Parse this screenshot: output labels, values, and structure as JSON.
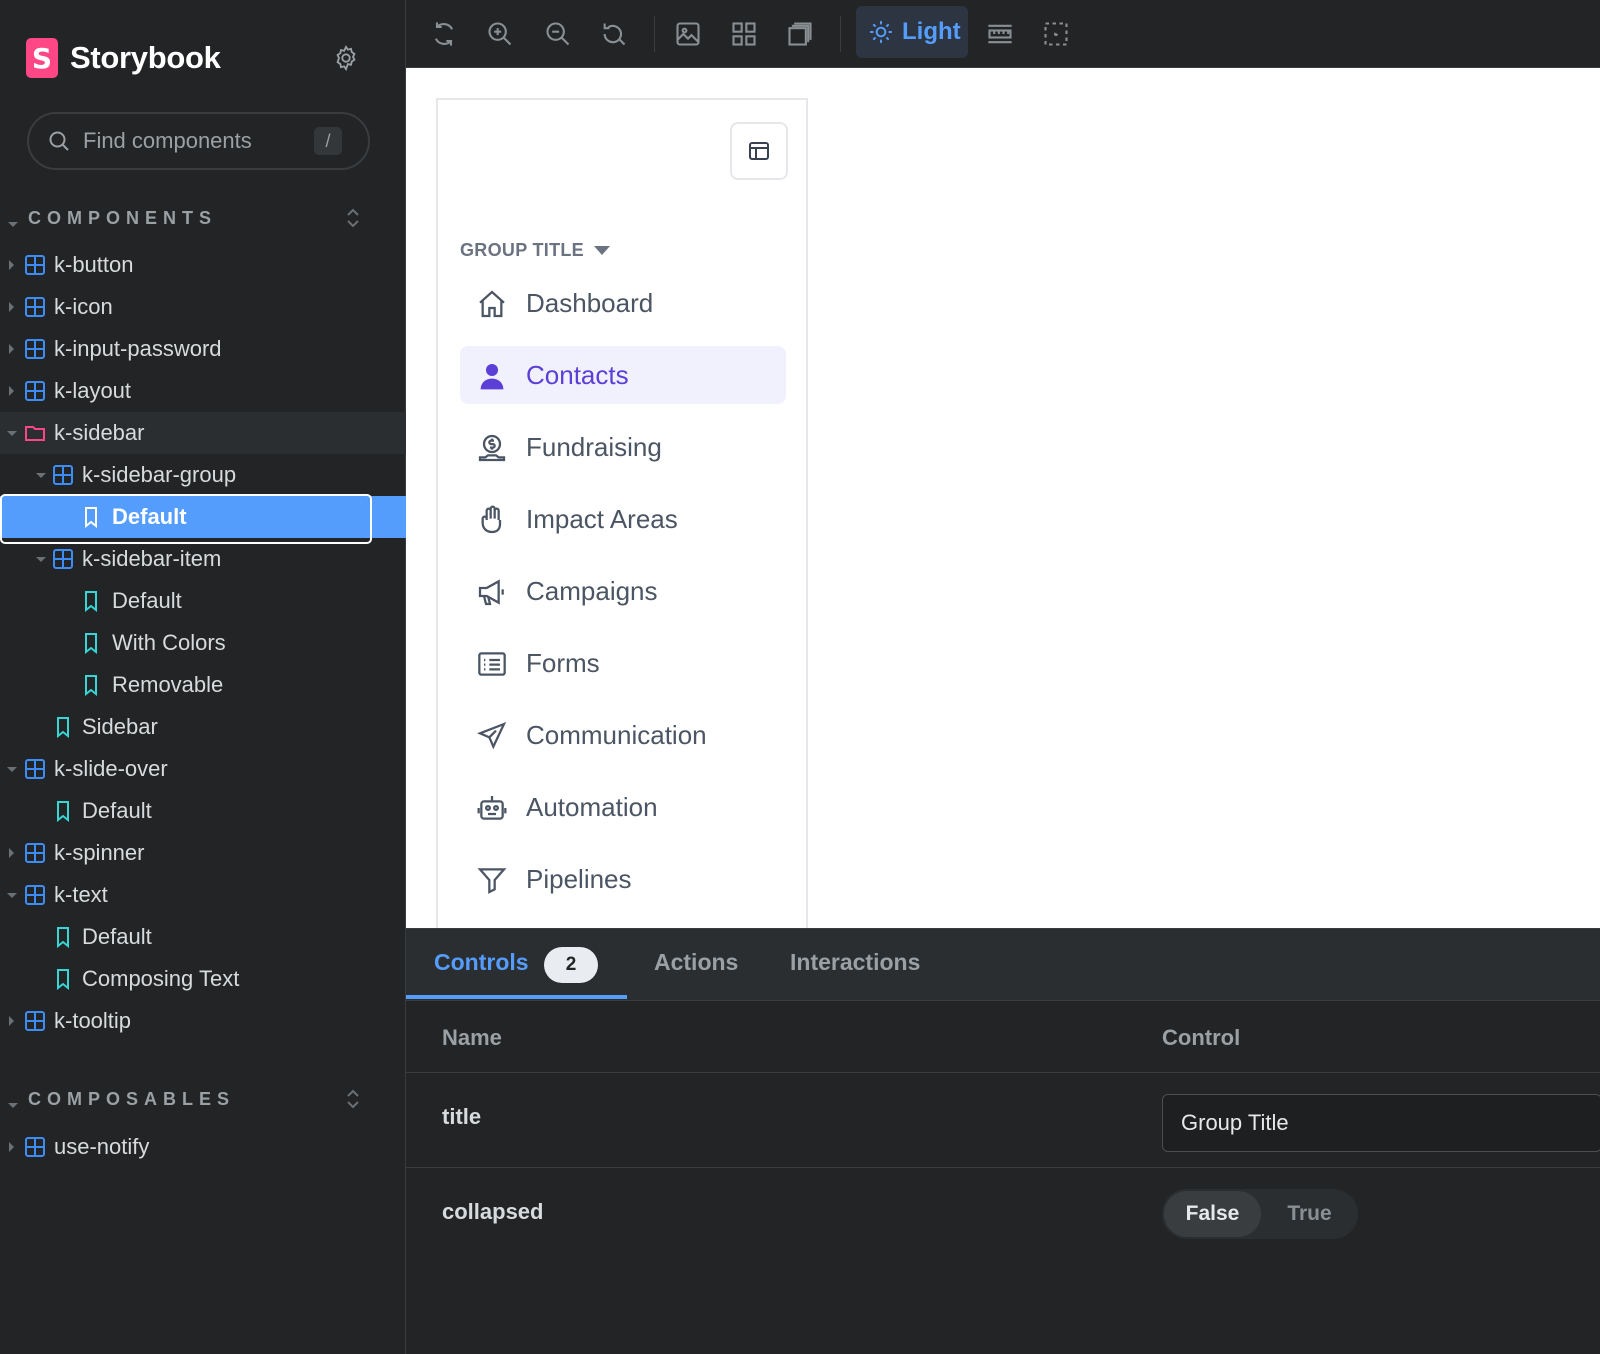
{
  "brand": {
    "name": "Storybook",
    "logo_letter": "S"
  },
  "search": {
    "placeholder": "Find components",
    "shortcut": "/"
  },
  "sections": [
    {
      "label": "COMPONENTS"
    },
    {
      "label": "COMPOSABLES"
    }
  ],
  "tree": [
    {
      "label": "k-button"
    },
    {
      "label": "k-icon"
    },
    {
      "label": "k-input-password"
    },
    {
      "label": "k-layout"
    },
    {
      "label": "k-sidebar"
    },
    {
      "label": "k-sidebar-group"
    },
    {
      "label": "Default"
    },
    {
      "label": "k-sidebar-item"
    },
    {
      "label": "Default"
    },
    {
      "label": "With Colors"
    },
    {
      "label": "Removable"
    },
    {
      "label": "Sidebar"
    },
    {
      "label": "k-slide-over"
    },
    {
      "label": "Default"
    },
    {
      "label": "k-spinner"
    },
    {
      "label": "k-text"
    },
    {
      "label": "Default"
    },
    {
      "label": "Composing Text"
    },
    {
      "label": "k-tooltip"
    },
    {
      "label": "use-notify"
    }
  ],
  "toolbar": {
    "theme_label": "Light"
  },
  "preview": {
    "group_title": "GROUP TITLE",
    "nav": [
      {
        "label": "Dashboard",
        "icon": "home-icon"
      },
      {
        "label": "Contacts",
        "icon": "user-icon"
      },
      {
        "label": "Fundraising",
        "icon": "donation-icon"
      },
      {
        "label": "Impact Areas",
        "icon": "hand-icon"
      },
      {
        "label": "Campaigns",
        "icon": "megaphone-icon"
      },
      {
        "label": "Forms",
        "icon": "form-icon"
      },
      {
        "label": "Communication",
        "icon": "send-icon"
      },
      {
        "label": "Automation",
        "icon": "robot-icon"
      },
      {
        "label": "Pipelines",
        "icon": "filter-icon"
      }
    ]
  },
  "panel": {
    "tabs": [
      {
        "label": "Controls",
        "badge": "2"
      },
      {
        "label": "Actions"
      },
      {
        "label": "Interactions"
      }
    ],
    "columns": {
      "name": "Name",
      "control": "Control"
    },
    "rows": {
      "title": {
        "name": "title",
        "value": "Group Title"
      },
      "collapsed": {
        "name": "collapsed",
        "options": [
          "False",
          "True"
        ],
        "selected": "False"
      }
    }
  },
  "colors": {
    "accent": "#559dfd",
    "brand": "#ff4785",
    "active_nav": "#5b3fd6"
  }
}
